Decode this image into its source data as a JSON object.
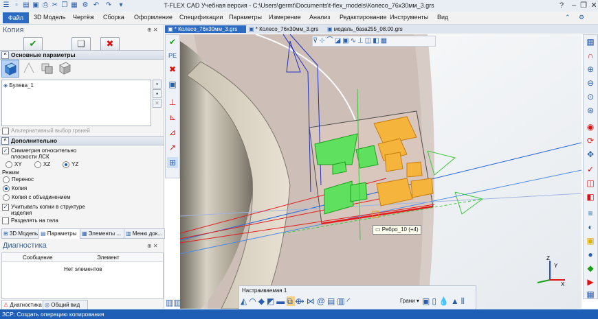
{
  "titlebar": {
    "title": "T-FLEX CAD Учебная версия - C:\\Users\\germt\\Documents\\t-flex_models\\Колесо_76x30мм_3.grs"
  },
  "menubar": {
    "file": "Файл",
    "items": [
      "3D Модель",
      "Чертёж",
      "Сборка",
      "Оформление",
      "Спецификации",
      "Параметры",
      "Измерение",
      "Анализ",
      "Редактирование",
      "Инструменты",
      "Вид"
    ]
  },
  "panel": {
    "title": "Копия",
    "pin": "⊕ ✕",
    "section_main": "Основные параметры",
    "list_item": "Булева_1",
    "alt_select": "Альтернативный выбор граней",
    "section_extra": "Дополнительно",
    "symmetry_label": "Симметрия относительно плоскости ЛСК",
    "planes": [
      "XY",
      "XZ",
      "YZ"
    ],
    "mode_label": "Режим",
    "modes": [
      "Перенос",
      "Копия",
      "Копия с объединением"
    ],
    "account_copies": "Учитывать копии в структуре изделия",
    "split_body": "Разделять на тела",
    "tabs": [
      "3D Модель",
      "Параметры",
      "Элементы ...",
      "Меню док..."
    ]
  },
  "diagnostics": {
    "title": "Диагностика",
    "col1": "Сообщение",
    "col2": "Элемент",
    "empty": "Нет элементов",
    "tabs": [
      "Диагностика",
      "Общий вид"
    ]
  },
  "doctabs": [
    "* Колесо_76x30мм_3.grs",
    "* Колесо_76x30мм_3.grs",
    "модель_база255_08.00.grs"
  ],
  "viewport": {
    "tooltip": "Ребро_10 (+4)",
    "axis_labels": [
      "Z",
      "Y",
      "X"
    ]
  },
  "bottom_toolbar": {
    "title": "Настраиваемая 1",
    "faces_label": "Грани"
  },
  "status": {
    "text": "ЗСР: Создать операцию копирования"
  },
  "colors": {
    "accent": "#1e5eb6",
    "selection": "#ffa500",
    "preview": "#33dd33"
  }
}
